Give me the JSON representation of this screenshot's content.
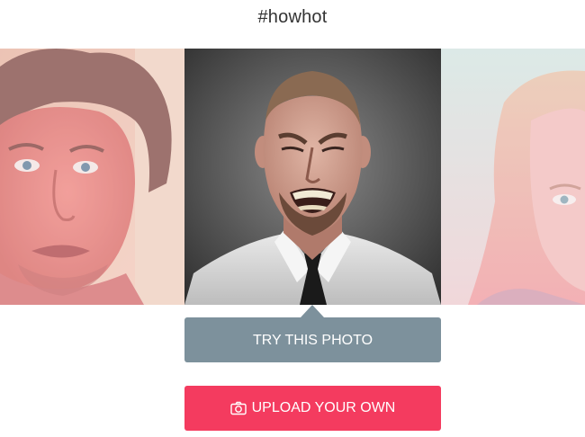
{
  "header": {
    "hashtag": "#howhot"
  },
  "carousel": {
    "photos": [
      {
        "position": "left",
        "state": "inactive",
        "tint": "#f2a0a0"
      },
      {
        "position": "center",
        "state": "active",
        "tint": "none"
      },
      {
        "position": "right",
        "state": "inactive",
        "tint": "#f2b2bf"
      }
    ]
  },
  "actions": {
    "try_label": "TRY THIS PHOTO",
    "upload_label": "UPLOAD YOUR OWN",
    "upload_icon": "camera-icon"
  },
  "colors": {
    "try_button": "#7d919c",
    "upload_button": "#f43b5f",
    "hashtag_text": "#333333"
  }
}
